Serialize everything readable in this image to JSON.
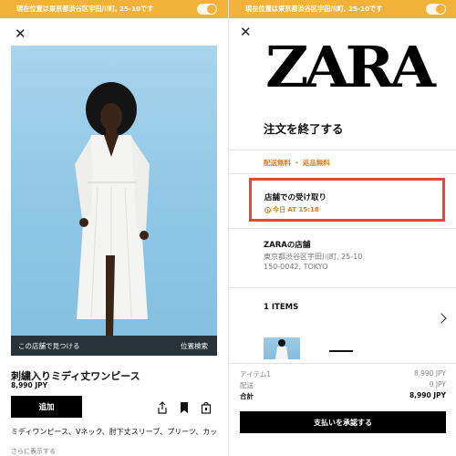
{
  "banner": {
    "location_text": "現在位置は東京都渋谷区宇田川町, 25-10です"
  },
  "left": {
    "store_bar": {
      "find_in_store": "この店舗で見つける",
      "location_search": "位置検索"
    },
    "product": {
      "name": "刺繍入りミディ丈ワンピース",
      "price": "8,990 JPY",
      "add_label": "追加",
      "description": "ミディワンピース、Vネック、肘下丈スリーブ、プリーツ、カットワーク刺繍ディテール、マッチングライナー、ボタンア…",
      "more_label": "さらに表示する"
    },
    "icons": [
      "share-icon",
      "bookmark-icon",
      "bag-icon"
    ]
  },
  "right": {
    "brand": "ZARA",
    "title": "注文を終了する",
    "shipping_note": "配送無料 ・ 返品無料",
    "pickup": {
      "title": "店舗での受け取り",
      "time": "今日 AT 15:18"
    },
    "store": {
      "name": "ZARAの店舗",
      "address_line1": "東京都渋谷区宇田川町, 25-10",
      "address_line2": "150-0042, TOKYO"
    },
    "items_label": "1 ITEMS",
    "summary": [
      {
        "label": "アイテム1",
        "value": "8,990 JPY"
      },
      {
        "label": "配送",
        "value": "0 JPY"
      },
      {
        "label": "合計",
        "value": "8,990 JPY"
      }
    ],
    "confirm_label": "支払いを承認する"
  },
  "colors": {
    "banner": "#f2b23a",
    "accent_orange": "#e07b15",
    "highlight_red": "#e2473a",
    "photo_bg": "#8ec6e6"
  }
}
